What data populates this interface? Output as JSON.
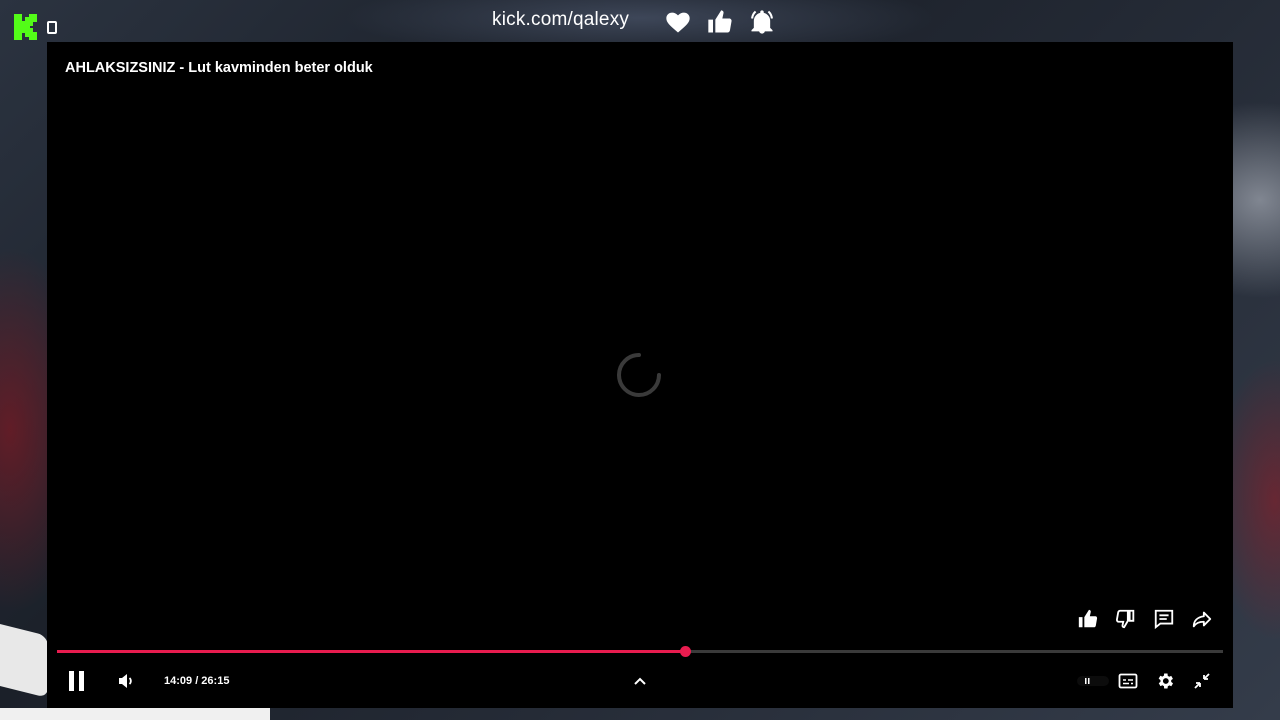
{
  "overlay": {
    "channel_url": "kick.com/qalexy",
    "accent_color": "#53fc18",
    "icons": [
      "kick-logo",
      "square-icon",
      "heart-icon",
      "thumbs-up-icon",
      "bell-icon"
    ]
  },
  "player": {
    "title": "AHLAKSIZSINIZ - Lut kavminden beter olduk",
    "state": "loading",
    "time_display": "14:09 / 26:15",
    "progress": 0.539,
    "progress_color": "#e81c4f",
    "side_actions": [
      "like-icon",
      "dislike-icon",
      "comments-icon",
      "share-icon"
    ],
    "controls": [
      "pause-icon",
      "volume-icon",
      "chevron-up-icon",
      "autoplay-toggle",
      "captions-icon",
      "settings-icon",
      "exit-fullscreen-icon"
    ]
  }
}
